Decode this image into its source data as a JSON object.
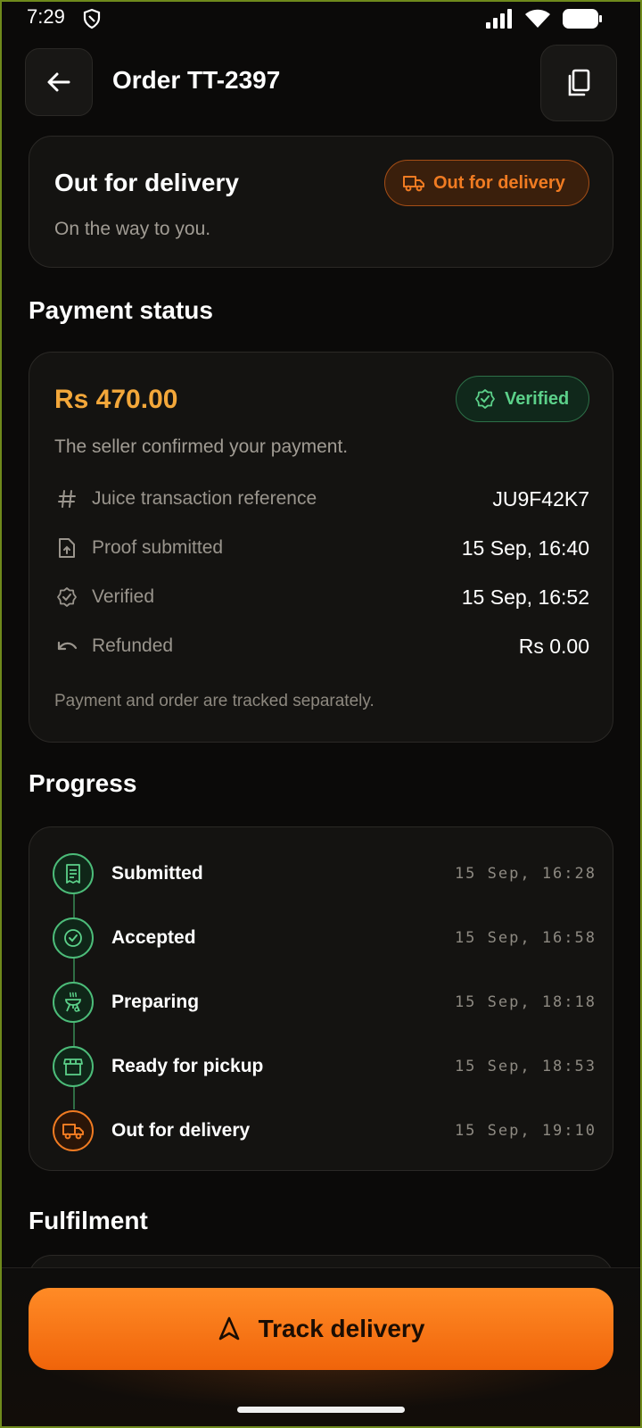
{
  "status_bar": {
    "time": "7:29"
  },
  "header": {
    "title": "Order TT-2397"
  },
  "order_status": {
    "title": "Out for delivery",
    "subtitle": "On the way to you.",
    "badge": "Out for delivery"
  },
  "payment": {
    "section_title": "Payment status",
    "amount": "Rs 470.00",
    "badge": "Verified",
    "description": "The seller confirmed your payment.",
    "rows": [
      {
        "icon": "hash-icon",
        "label": "Juice transaction reference",
        "value": "JU9F42K7"
      },
      {
        "icon": "upload-file-icon",
        "label": "Proof submitted",
        "value": "15 Sep, 16:40"
      },
      {
        "icon": "verified-badge-icon",
        "label": "Verified",
        "value": "15 Sep, 16:52"
      },
      {
        "icon": "undo-icon",
        "label": "Refunded",
        "value": "Rs 0.00"
      }
    ],
    "note": "Payment and order are tracked separately."
  },
  "progress": {
    "section_title": "Progress",
    "steps": [
      {
        "icon": "receipt-icon",
        "name": "Submitted",
        "time": "15 Sep, 16:28"
      },
      {
        "icon": "check-circle-icon",
        "name": "Accepted",
        "time": "15 Sep, 16:58"
      },
      {
        "icon": "grill-icon",
        "name": "Preparing",
        "time": "15 Sep, 18:18"
      },
      {
        "icon": "store-icon",
        "name": "Ready for pickup",
        "time": "15 Sep, 18:53"
      },
      {
        "icon": "truck-icon",
        "name": "Out for delivery",
        "time": "15 Sep, 19:10"
      }
    ]
  },
  "fulfilment": {
    "section_title": "Fulfilment"
  },
  "cta": {
    "label": "Track delivery"
  },
  "colors": {
    "accent": "#f07b22",
    "success": "#5cd18a",
    "amount": "#f3a73a",
    "background": "#0b0a09"
  }
}
